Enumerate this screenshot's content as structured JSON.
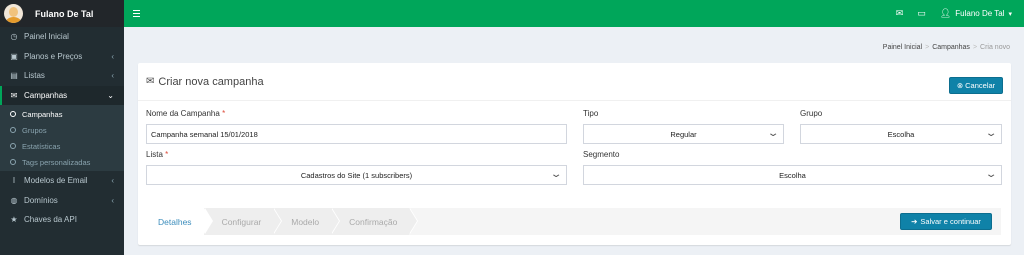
{
  "sidebar": {
    "user_name": "Fulano De Tal",
    "items": [
      {
        "label": "Painel Inicial",
        "icon": "dashboard-icon"
      },
      {
        "label": "Planos e Preços",
        "icon": "cubes-icon"
      },
      {
        "label": "Listas",
        "icon": "list-table-icon"
      },
      {
        "label": "Campanhas",
        "icon": "envelope-icon"
      },
      {
        "label": "Modelos de Email",
        "icon": "text-cursor-icon"
      },
      {
        "label": "Domínios",
        "icon": "globe-icon"
      },
      {
        "label": "Chaves da API",
        "icon": "star-icon"
      }
    ],
    "subitems": [
      "Campanhas",
      "Grupos",
      "Estatísticas",
      "Tags personalizadas"
    ]
  },
  "topbar": {
    "user_name": "Fulano De Tal"
  },
  "breadcrumb": {
    "home": "Painel Inicial",
    "section": "Campanhas",
    "current": "Cria novo"
  },
  "form": {
    "title": "Criar nova campanha",
    "cancel_label": "Cancelar",
    "name_label": "Nome da Campanha",
    "name_value": "Campanha semanal 15/01/2018",
    "tipo_label": "Tipo",
    "tipo_value": "Regular",
    "grupo_label": "Grupo",
    "grupo_value": "Escolha",
    "lista_label": "Lista",
    "lista_value": "Cadastros do Site (1 subscribers)",
    "segmento_label": "Segmento",
    "segmento_value": "Escolha",
    "required_mark": "*"
  },
  "wizard": {
    "steps": [
      "Detalhes",
      "Configurar",
      "Modelo",
      "Confirmação"
    ],
    "save_label": "Salvar e continuar"
  },
  "colors": {
    "accent": "#00a65a",
    "primary": "#0f82a8",
    "sidebar": "#222d32"
  }
}
